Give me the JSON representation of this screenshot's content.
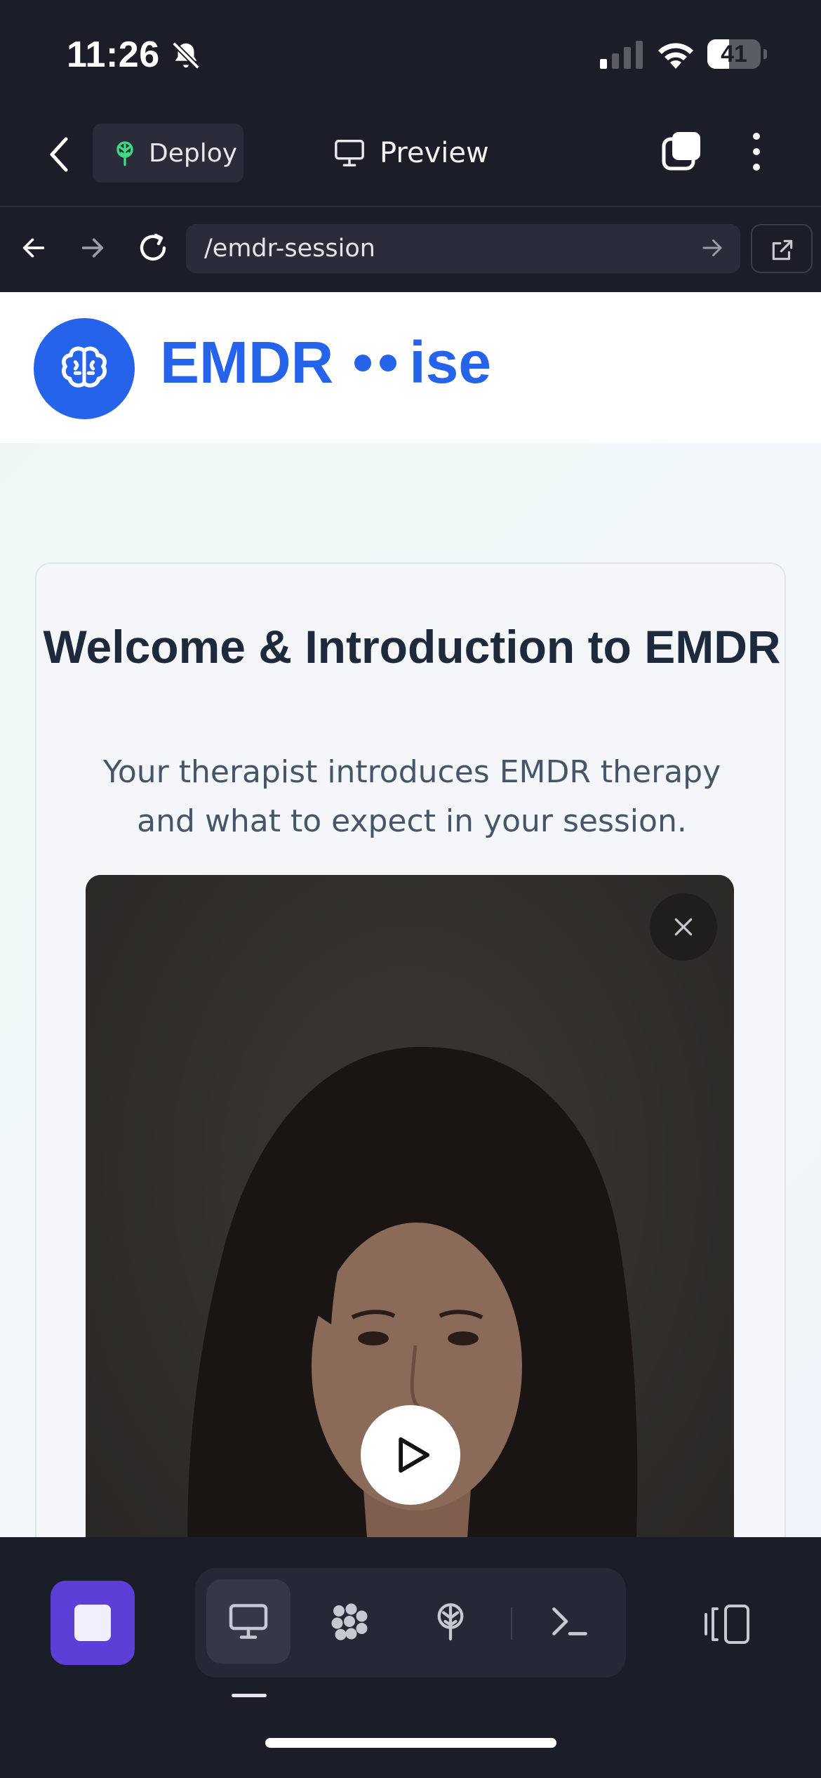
{
  "status_bar": {
    "time": "11:26",
    "battery_level": "41",
    "battery_fraction": 0.41,
    "icons": [
      "bell-slash-icon",
      "cellular-signal-icon",
      "wifi-icon",
      "battery-icon"
    ]
  },
  "toolbar": {
    "deploy_label": "Deploy",
    "preview_label": "Preview",
    "icons": [
      "back-chevron-icon",
      "deploy-tree-icon",
      "monitor-icon",
      "tabs-icon",
      "more-vertical-icon"
    ]
  },
  "browser": {
    "url": "/emdr-session",
    "icons": [
      "arrow-left-icon",
      "arrow-right-icon",
      "reload-icon",
      "go-arrow-icon",
      "open-external-icon"
    ]
  },
  "site": {
    "brand_left": "EMDR",
    "brand_right": "ise",
    "logo_icon": "brain-icon"
  },
  "session": {
    "title": "Welcome & Introduction to EMDR",
    "subtitle": "Your therapist introduces EMDR therapy and what to expect in your session.",
    "video_icons": [
      "close-icon",
      "play-icon"
    ]
  },
  "dock": {
    "items": [
      "stop-icon",
      "monitor-icon",
      "network-icon",
      "deploy-tree-icon",
      "terminal-icon",
      "split-view-icon"
    ],
    "active_item": "monitor"
  },
  "colors": {
    "brand_blue": "#2563eb",
    "stop_purple": "#5b3fd6",
    "deploy_green": "#3ddc84",
    "app_background": "#1b1d28"
  }
}
